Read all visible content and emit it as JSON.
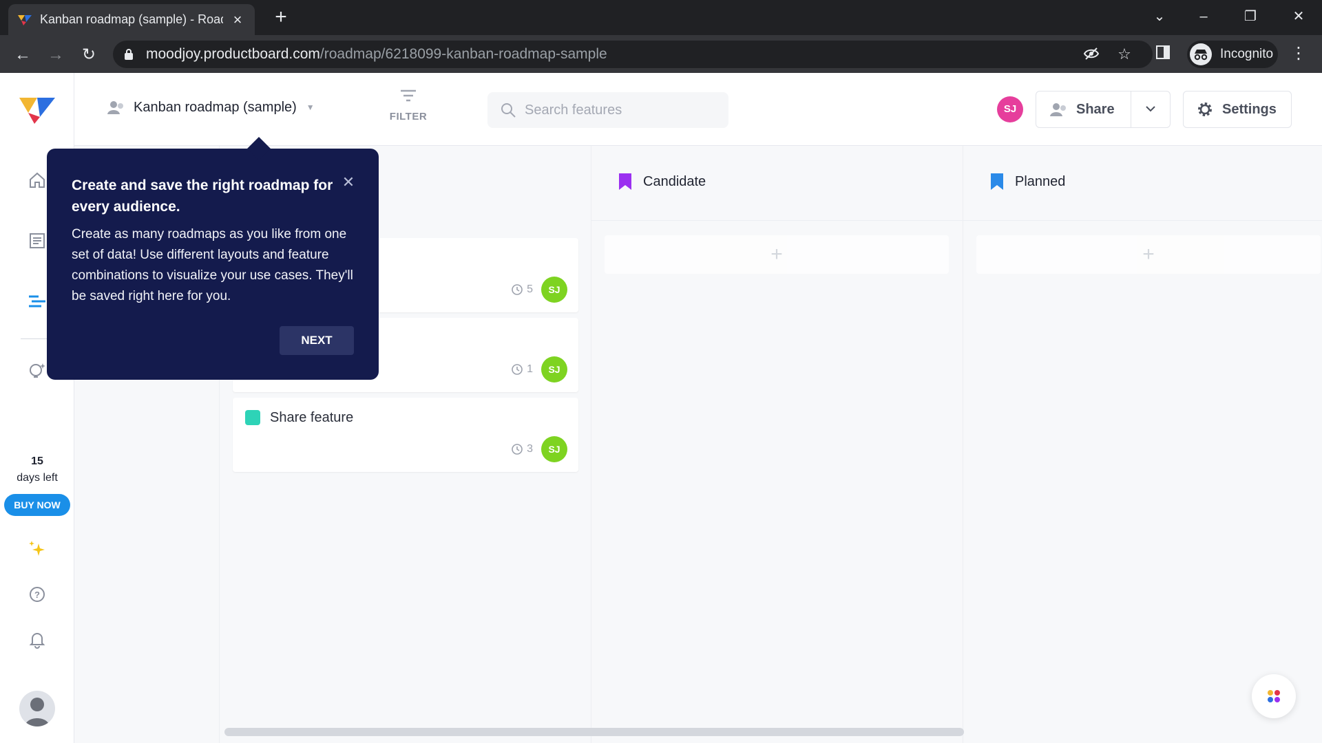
{
  "browser": {
    "tab_title": "Kanban roadmap (sample) - Roadmap",
    "url_host": "moodjoy.productboard.com",
    "url_path": "/roadmap/6218099-kanban-roadmap-sample",
    "incognito_label": "Incognito"
  },
  "header": {
    "roadmap_name": "Kanban roadmap (sample)",
    "filter_label": "FILTER",
    "search_placeholder": "Search features",
    "user_initials": "SJ",
    "share_label": "Share",
    "settings_label": "Settings"
  },
  "sidebar": {
    "trial_days": "15",
    "trial_label": "days left",
    "buy_label": "BUY NOW"
  },
  "columns": [
    {
      "title": "Candidate",
      "color": "#9b30f0"
    },
    {
      "title": "Planned",
      "color": "#2b8ae8"
    }
  ],
  "cards": [
    {
      "title": "",
      "count": "5",
      "initials": "SJ",
      "color": "#1f5fbf"
    },
    {
      "title": "",
      "count": "1",
      "initials": "SJ",
      "color": "#1f5fbf"
    },
    {
      "title": "Share feature",
      "count": "3",
      "initials": "SJ",
      "color": "#2ed3b7"
    }
  ],
  "popover": {
    "title": "Create and save the right roadmap for every audience.",
    "body": "Create as many roadmaps as you like from one set of data! Use different layouts and feature combinations to visualize your use cases. They'll be saved right here for you.",
    "next_label": "NEXT"
  },
  "colors": {
    "brand_blue": "#1a8fe8",
    "popover_bg": "#141b4d",
    "avatar_pink": "#e63e9c",
    "avatar_green": "#7ed321"
  }
}
